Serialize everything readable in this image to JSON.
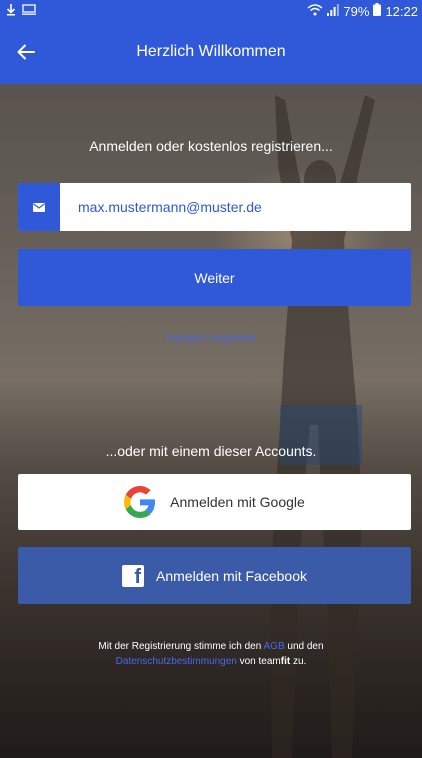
{
  "status_bar": {
    "battery": "79%",
    "time": "12:22"
  },
  "header": {
    "title": "Herzlich Willkommen"
  },
  "login": {
    "subtitle": "Anmelden oder kostenlos registrieren...",
    "email_value": "max.mustermann@muster.de",
    "continue_label": "Weiter",
    "forgot_password": "Passwort vergessen"
  },
  "social": {
    "heading": "...oder mit einem dieser Accounts.",
    "google_label": "Anmelden mit Google",
    "facebook_label": "Anmelden mit Facebook"
  },
  "terms": {
    "line1_prefix": "Mit der Registrierung stimme ich den",
    "agb": "AGB",
    "line1_suffix": "und den",
    "privacy": "Datenschutzbestimmungen",
    "line2_prefix": "von team",
    "brand_bold": "fit",
    "line2_suffix": "zu."
  },
  "colors": {
    "primary": "#2f59d8",
    "facebook": "#3b5aa8",
    "link": "#4a68e8"
  }
}
